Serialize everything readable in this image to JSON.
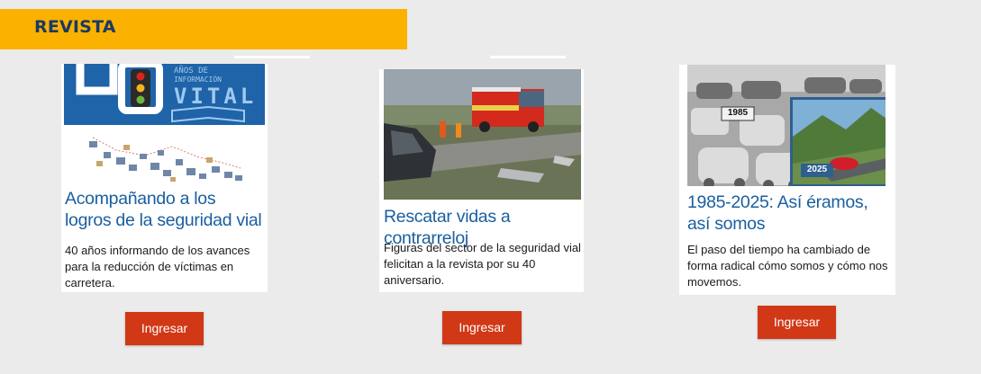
{
  "header": {
    "title": "REVISTA"
  },
  "cards": [
    {
      "title": "Acompañando a los logros de la seguridad vial",
      "description": "40 años informando de los avances para la reducción de víctimas en carretera.",
      "button_label": "Ingresar",
      "image_text": {
        "line1": "AÑOS DE",
        "line2": "INFORMACIÓN",
        "line3": "VITAL"
      }
    },
    {
      "title": "Rescatar vidas a contrarreloj",
      "description": "Figuras del sector de la seguridad vial felicitan a la revista por su 40 aniversario.",
      "button_label": "Ingresar"
    },
    {
      "title": "1985-2025: Así éramos, así somos",
      "description": "El paso del tiempo ha cambiado de forma radical cómo somos y cómo nos movemos.",
      "button_label": "Ingresar",
      "image_text": {
        "label_old": "1985",
        "label_new": "2025"
      }
    }
  ],
  "colors": {
    "header_band": "#fbb100",
    "header_text": "#1b3a63",
    "title_blue": "#1a5fa0",
    "button_red": "#d13816",
    "background": "#ebebeb"
  }
}
